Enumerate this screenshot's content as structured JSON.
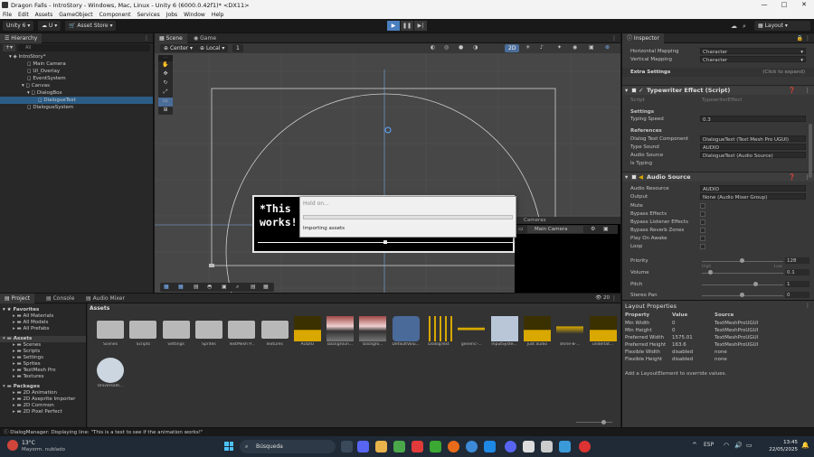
{
  "window": {
    "title": "Dragon Falls - IntroStory - Windows, Mac, Linux - Unity 6 (6000.0.42f1)* <DX11>",
    "controls": [
      "—",
      "□",
      "✕"
    ]
  },
  "menu": [
    "File",
    "Edit",
    "Assets",
    "GameObject",
    "Component",
    "Services",
    "Jobs",
    "Window",
    "Help"
  ],
  "toolbar": {
    "account": "Unity 6",
    "cloud": "U",
    "asset_store": "Asset Store",
    "layout": "Layout"
  },
  "hierarchy": {
    "tab": "Hierarchy",
    "search_placeholder": "All",
    "items": [
      {
        "label": "IntroStory*",
        "depth": 0
      },
      {
        "label": "Main Camera",
        "depth": 1
      },
      {
        "label": "UI_Overlay",
        "depth": 1
      },
      {
        "label": "EventSystem",
        "depth": 1
      },
      {
        "label": "Canvas",
        "depth": 1
      },
      {
        "label": "DialogBox",
        "depth": 2
      },
      {
        "label": "DialogueText",
        "depth": 3
      },
      {
        "label": "DialogueSystem",
        "depth": 1
      }
    ]
  },
  "scene": {
    "tabs": [
      "Scene",
      "Game"
    ],
    "pivot": "Center",
    "space": "Local",
    "grid": "1",
    "mode2d": "2D",
    "preview_text": "*This\nworks!",
    "cameras_overlay": {
      "title": "Cameras",
      "selected": "Main Camera"
    }
  },
  "dialog": {
    "title": "Hold on...",
    "message": "Importing assets",
    "progress": 0.0
  },
  "inspector": {
    "tab": "Inspector",
    "top_rows": [
      {
        "label": "Horizontal Mapping",
        "value": "Character"
      },
      {
        "label": "Vertical Mapping",
        "value": "Character"
      }
    ],
    "extra_settings": "Extra Settings",
    "expand_hint": "(Click to expand)",
    "typewriter": {
      "title": "Typewriter Effect (Script)",
      "script_label": "Script",
      "script_value": "TypewriterEffect",
      "settings": "Settings",
      "typing_speed_label": "Typing Speed",
      "typing_speed": "0.3",
      "references": "References",
      "rows": [
        {
          "label": "Dialog Text Component",
          "value": "DialogueText (Text Mesh Pro UGUI)"
        },
        {
          "label": "Type Sound",
          "value": "AUDIO"
        },
        {
          "label": "Audio Source",
          "value": "DialogueText (Audio Source)"
        },
        {
          "label": "Is Typing",
          "value": ""
        }
      ]
    },
    "audio": {
      "title": "Audio Source",
      "rows": [
        {
          "label": "Audio Resource",
          "value": "AUDIO"
        },
        {
          "label": "Output",
          "value": "None (Audio Mixer Group)"
        },
        {
          "label": "Mute",
          "value": ""
        },
        {
          "label": "Bypass Effects",
          "value": ""
        },
        {
          "label": "Bypass Listener Effects",
          "value": ""
        },
        {
          "label": "Bypass Reverb Zones",
          "value": ""
        },
        {
          "label": "Play On Awake",
          "value": ""
        },
        {
          "label": "Loop",
          "value": ""
        }
      ],
      "priority_label": "Priority",
      "priority": "128",
      "high": "High",
      "low": "Low",
      "volume_label": "Volume",
      "volume": "0.1",
      "pitch_label": "Pitch",
      "pitch": "1",
      "stereo_label": "Stereo Pan",
      "stereo": "0"
    }
  },
  "layout_properties": {
    "title": "Layout Properties",
    "headers": [
      "Property",
      "Value",
      "Source"
    ],
    "rows": [
      [
        "Min Width",
        "0",
        "TextMeshProUGUI"
      ],
      [
        "Min Height",
        "0",
        "TextMeshProUGUI"
      ],
      [
        "Preferred Width",
        "1575.01",
        "TextMeshProUGUI"
      ],
      [
        "Preferred Height",
        "163.6",
        "TextMeshProUGUI"
      ],
      [
        "Flexible Width",
        "disabled",
        "none"
      ],
      [
        "Flexible Height",
        "disabled",
        "none"
      ]
    ],
    "hint": "Add a LayoutElement to override values."
  },
  "project": {
    "tabs": [
      "Project",
      "Console",
      "Audio Mixer"
    ],
    "breadcrumb": "Assets",
    "count": "20",
    "tree": [
      {
        "label": "Favorites",
        "depth": 0,
        "bold": true
      },
      {
        "label": "All Materials",
        "depth": 1
      },
      {
        "label": "All Models",
        "depth": 1
      },
      {
        "label": "All Prefabs",
        "depth": 1
      },
      {
        "label": "Assets",
        "depth": 0,
        "bold": true,
        "sel": true
      },
      {
        "label": "Scenes",
        "depth": 1
      },
      {
        "label": "Scripts",
        "depth": 1
      },
      {
        "label": "Settings",
        "depth": 1
      },
      {
        "label": "Sprites",
        "depth": 1
      },
      {
        "label": "TextMesh Pro",
        "depth": 1
      },
      {
        "label": "Textures",
        "depth": 1
      },
      {
        "label": "Packages",
        "depth": 0,
        "bold": true
      },
      {
        "label": "2D Animation",
        "depth": 1
      },
      {
        "label": "2D Aseprite Importer",
        "depth": 1
      },
      {
        "label": "2D Common",
        "depth": 1
      },
      {
        "label": "2D Pixel Perfect",
        "depth": 1
      }
    ],
    "assets": [
      {
        "name": "Scenes",
        "kind": "folder"
      },
      {
        "name": "Scripts",
        "kind": "folder"
      },
      {
        "name": "Settings",
        "kind": "folder"
      },
      {
        "name": "Sprites",
        "kind": "folder"
      },
      {
        "name": "TextMesh P...",
        "kind": "folder"
      },
      {
        "name": "Textures",
        "kind": "folder"
      },
      {
        "name": "AUDIO",
        "kind": "audio"
      },
      {
        "name": "backgroun...",
        "kind": "image"
      },
      {
        "name": "backgro...",
        "kind": "image"
      },
      {
        "name": "DefaultVolu...",
        "kind": "cube"
      },
      {
        "name": "DialogText",
        "kind": "sliders"
      },
      {
        "name": "generic-...",
        "kind": "wave"
      },
      {
        "name": "InputSyste...",
        "kind": "input"
      },
      {
        "name": "Just audio",
        "kind": "audio"
      },
      {
        "name": "shine-8-...",
        "kind": "note"
      },
      {
        "name": "underlat...",
        "kind": "audio"
      },
      {
        "name": "UniversalR...",
        "kind": "urp"
      }
    ]
  },
  "status": {
    "message": "DialogManager: Displaying line: \"This is a test to see if the animation works!\""
  },
  "taskbar": {
    "weather_temp": "13°C",
    "weather_desc": "Mayorm. nublado",
    "search": "Búsqueda",
    "lang": "ESP",
    "time": "13:45",
    "date": "22/05/2025"
  },
  "colors": {
    "selection": "#2c5d87",
    "panel": "#282828",
    "inspector": "#383838",
    "scene": "#474747",
    "taskbar": "#1f2a36",
    "accent_audio": "#d8a800"
  }
}
